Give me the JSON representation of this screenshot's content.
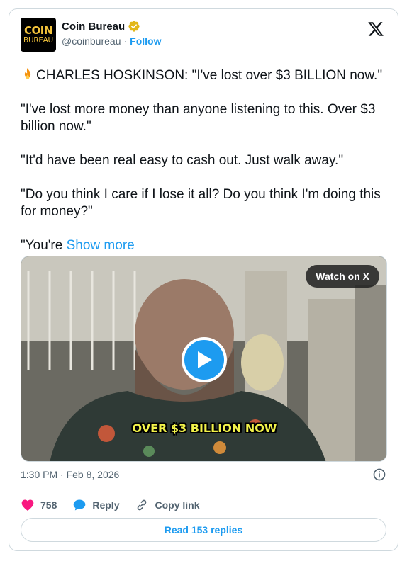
{
  "author": {
    "display_name": "Coin Bureau",
    "handle": "@coinbureau",
    "separator": "·",
    "follow_label": "Follow",
    "avatar_line1": "COIN",
    "avatar_line2": "BUREAU"
  },
  "tweet": {
    "line_1": "CHARLES HOSKINSON: \"I've lost over $3 BILLION now.\"",
    "line_2": "\"I've lost more money than anyone listening to this. Over $3 billion now.\"",
    "line_3": "\"It'd have been real easy to cash out. Just walk away.\"",
    "line_4": "\"Do you think I care if I lose it all? Do you think I'm doing this for money?\"",
    "line_5": "\"You're",
    "show_more": "Show more"
  },
  "media": {
    "watch_label": "Watch on X",
    "caption": "OVER $3 BILLION NOW"
  },
  "meta": {
    "timestamp": "1:30 PM · Feb 8, 2026"
  },
  "actions": {
    "likes": "758",
    "reply_label": "Reply",
    "copy_label": "Copy link"
  },
  "replies_button": "Read 153 replies",
  "colors": {
    "accent": "#1d9bf0",
    "like": "#f91880",
    "verified": "#e2b719"
  },
  "icons": [
    "fire-icon",
    "verified-badge-icon",
    "x-logo-icon",
    "play-icon",
    "info-icon",
    "heart-icon",
    "reply-icon",
    "link-icon"
  ]
}
